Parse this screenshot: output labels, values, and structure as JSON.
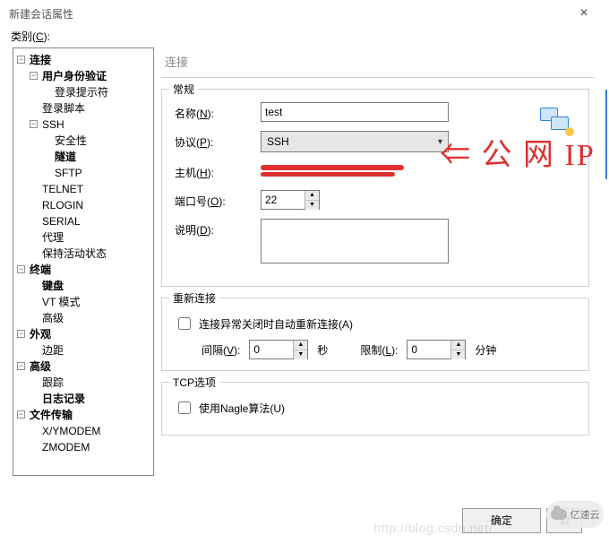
{
  "window": {
    "title": "新建会话属性",
    "close_glyph": "×"
  },
  "category_label": {
    "text": "类别(",
    "u": "C",
    "suffix": "):"
  },
  "tree": {
    "connection": "连接",
    "auth": "用户身份验证",
    "login_prompt": "登录提示符",
    "login_script": "登录脚本",
    "ssh": "SSH",
    "security": "安全性",
    "tunnel": "隧道",
    "sftp": "SFTP",
    "telnet": "TELNET",
    "rlogin": "RLOGIN",
    "serial": "SERIAL",
    "proxy": "代理",
    "keepalive": "保持活动状态",
    "terminal": "终端",
    "keyboard": "键盘",
    "vtmode": "VT 模式",
    "advanced_term": "高级",
    "appearance": "外观",
    "margin": "边距",
    "advanced": "高级",
    "trace": "跟踪",
    "log": "日志记录",
    "filetransfer": "文件传输",
    "xymodem": "X/YMODEM",
    "zmodem": "ZMODEM",
    "toggle_minus": "−",
    "toggle_plus": "+"
  },
  "panel": {
    "title": "连接",
    "group_general": "常规",
    "name_label": {
      "text": "名称(",
      "u": "N",
      "suffix": "):"
    },
    "name_value": "test",
    "proto_label": {
      "text": "协议(",
      "u": "P",
      "suffix": "):"
    },
    "proto_value": "SSH",
    "host_label": {
      "text": "主机(",
      "u": "H",
      "suffix": "):"
    },
    "port_label": {
      "text": "端口号(",
      "u": "O",
      "suffix": "):"
    },
    "port_value": "22",
    "desc_label": {
      "text": "说明(",
      "u": "D",
      "suffix": "):"
    },
    "desc_value": "",
    "group_reconnect": "重新连接",
    "reconnect_cb": {
      "text": "连接异常关闭时自动重新连接(",
      "u": "A",
      "suffix": ")"
    },
    "interval_label": {
      "text": "间隔(",
      "u": "V",
      "suffix": "):"
    },
    "interval_value": "0",
    "second_unit": "秒",
    "limit_label": {
      "text": "限制(",
      "u": "L",
      "suffix": "):"
    },
    "limit_value": "0",
    "minute_unit": "分钟",
    "group_tcp": "TCP选项",
    "nagle_cb": {
      "text": "使用Nagle算法(",
      "u": "U",
      "suffix": ")"
    }
  },
  "annotation": "⇐ 公 网 IP",
  "footer": {
    "ok": "确定",
    "cancel": "取",
    "cancel_visible_partial": true
  },
  "watermark": {
    "url": "http://blog.csdn.net/",
    "brand": "亿速云"
  },
  "icons": {
    "dropdown_arrow": "▾",
    "spinner_up": "▲",
    "spinner_down": "▼"
  }
}
